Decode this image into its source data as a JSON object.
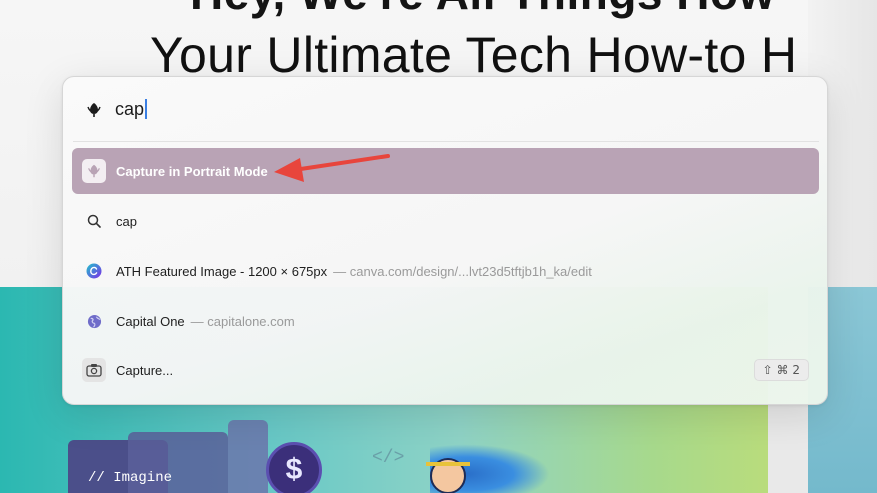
{
  "background": {
    "heading_cut": "Hey, We're All Things How",
    "subheading": "Your Ultimate Tech How-to H",
    "banner_card_text": "// Imagine",
    "coin_symbol": "$",
    "code_glyph": "</>"
  },
  "search": {
    "query": "cap",
    "icon": "tulip-icon"
  },
  "results": [
    {
      "id": "capture-portrait",
      "label": "Capture in Portrait Mode",
      "sub": "",
      "icon": "tulip-icon",
      "selected": true
    },
    {
      "id": "search-cap",
      "label": "cap",
      "sub": "",
      "icon": "magnifier-icon",
      "selected": false
    },
    {
      "id": "ath-featured",
      "label": "ATH Featured Image - 1200 × 675px",
      "sub": "— canva.com/design/...lvt23d5tftjb1h_ka/edit",
      "icon": "canva-icon",
      "selected": false
    },
    {
      "id": "capital-one",
      "label": "Capital One",
      "sub": "— capitalone.com",
      "icon": "globe-icon",
      "selected": false
    },
    {
      "id": "capture",
      "label": "Capture...",
      "sub": "",
      "icon": "camera-icon",
      "selected": false,
      "shortcut": "⇧ ⌘ 2"
    }
  ],
  "colors": {
    "selected_row": "#b9a3b5",
    "annotation_arrow": "#e8453c",
    "caret": "#3b7fe3"
  }
}
